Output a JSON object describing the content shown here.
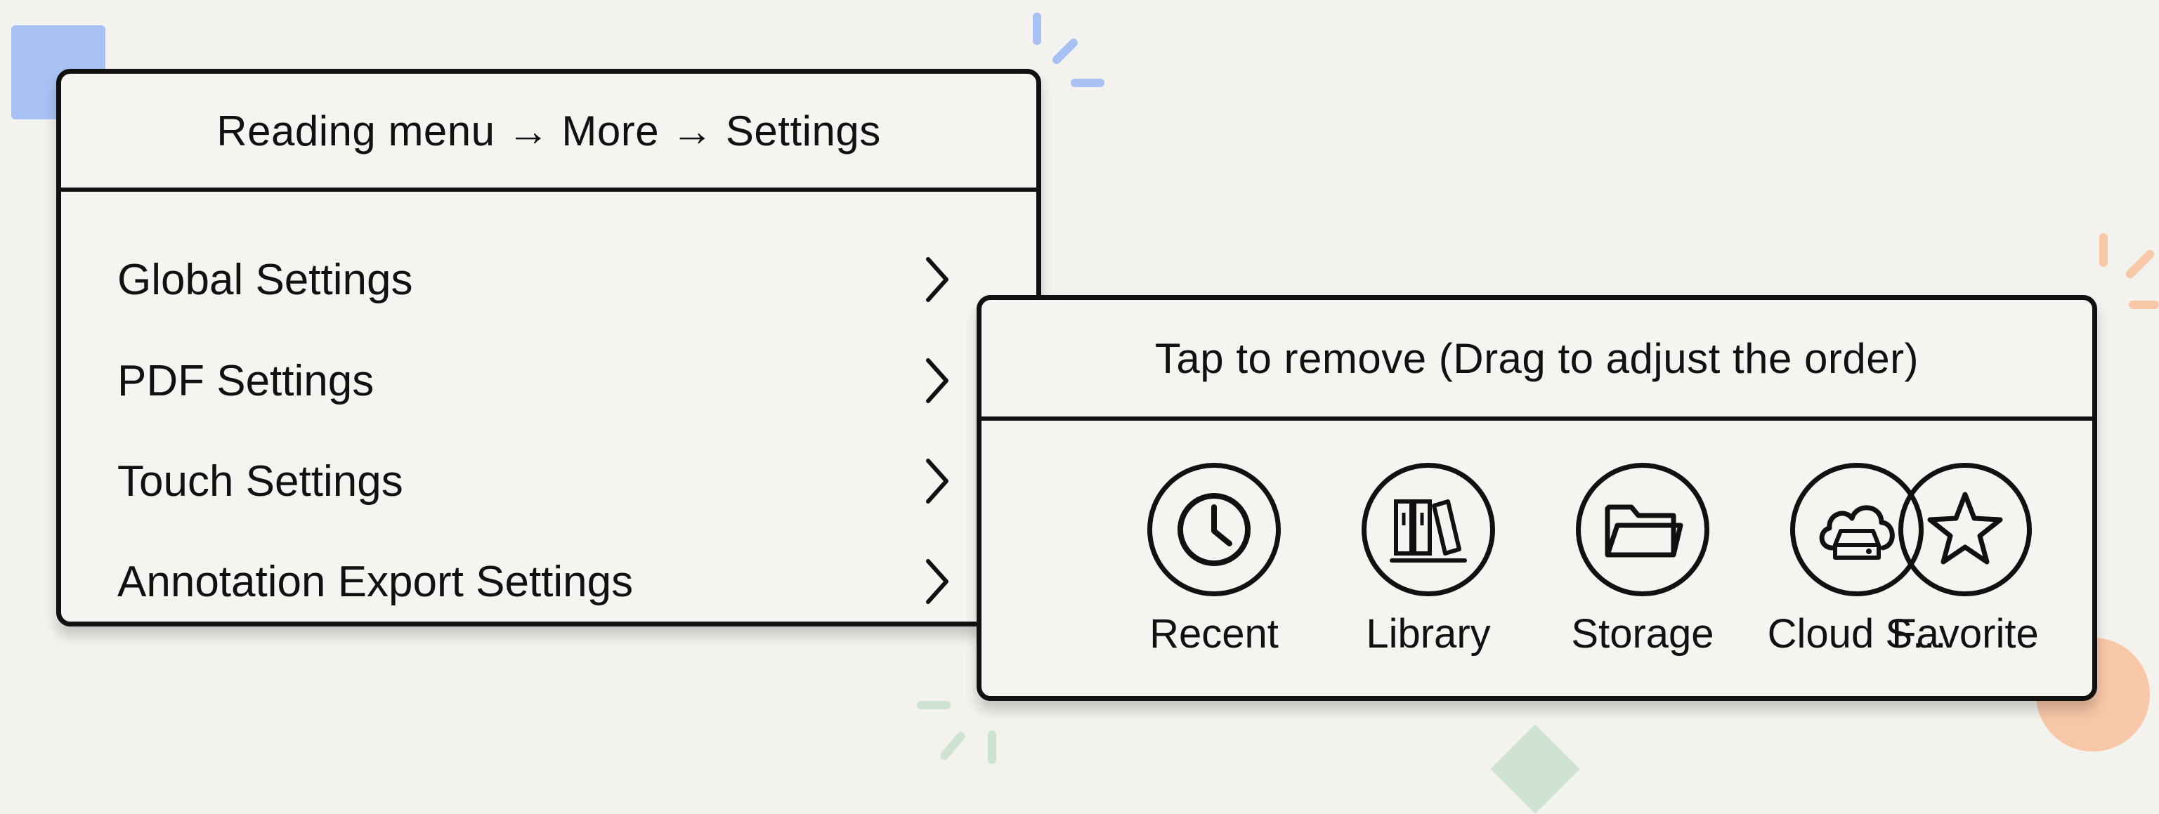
{
  "settings_menu": {
    "title": "Reading menu → More → Settings",
    "items": [
      {
        "label": "Global Settings"
      },
      {
        "label": "PDF Settings"
      },
      {
        "label": "Touch Settings"
      },
      {
        "label": "Annotation Export Settings"
      }
    ]
  },
  "shortcut_panel": {
    "title": "Tap to remove (Drag to adjust the order)",
    "items": [
      {
        "label": "Recent",
        "icon": "clock-icon"
      },
      {
        "label": "Library",
        "icon": "books-icon"
      },
      {
        "label": "Storage",
        "icon": "folder-icon"
      },
      {
        "label": "Cloud S...",
        "icon": "cloud-drive-icon"
      },
      {
        "label": "Favorite",
        "icon": "star-icon"
      }
    ]
  },
  "colors": {
    "background": "#f3f2ee",
    "panel": "#f5f4f0",
    "border": "#111111",
    "accent_blue": "#a8c1f4",
    "accent_orange": "#f8c7a7",
    "accent_green": "#cfe3d2"
  }
}
